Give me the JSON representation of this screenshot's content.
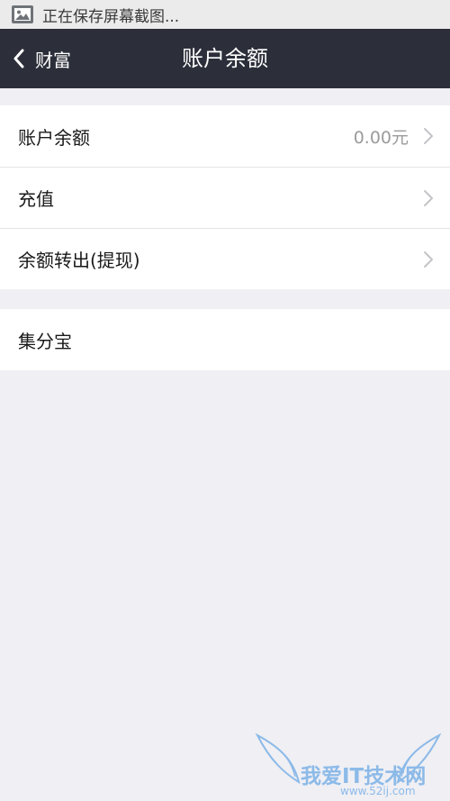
{
  "status_bar": {
    "icon": "image-icon",
    "text": "正在保存屏幕截图..."
  },
  "nav": {
    "back_icon": "chevron-left-icon",
    "back_label": "财富",
    "title": "账户余额"
  },
  "groups": [
    {
      "rows": [
        {
          "label": "账户余额",
          "value": "0.00元",
          "icon": "chevron-right-icon"
        },
        {
          "label": "充值",
          "icon": "chevron-right-icon"
        },
        {
          "label": "余额转出(提现)",
          "icon": "chevron-right-icon"
        }
      ]
    },
    {
      "rows": [
        {
          "label": "集分宝"
        }
      ]
    }
  ],
  "watermark": {
    "title": "我爱IT技术网",
    "url": "www.52ij.com"
  },
  "colors": {
    "nav_background": "#2c2f3a",
    "page_background": "#efeff4",
    "status_bar_background": "#ebebeb",
    "watermark": "#3d8fdf"
  }
}
